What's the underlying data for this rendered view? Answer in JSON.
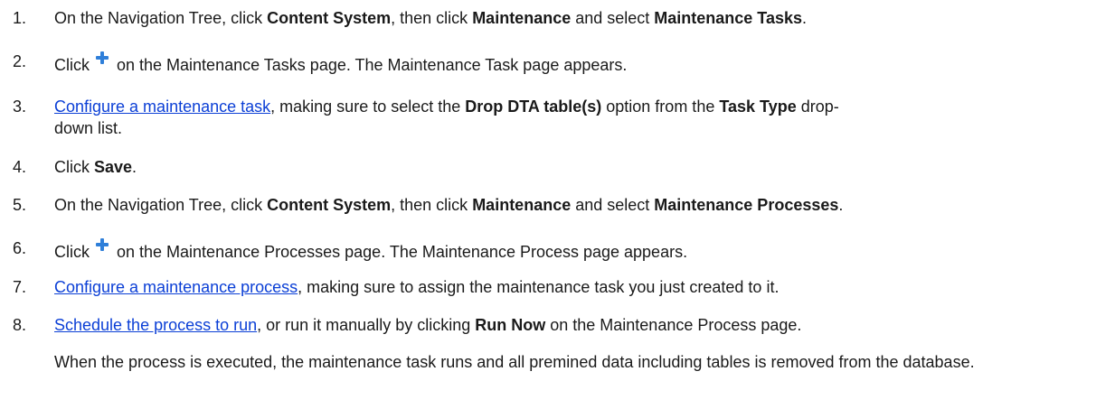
{
  "steps": [
    {
      "number": "1.",
      "t1": "On the Navigation Tree, click ",
      "b1": "Content System",
      "t2": ", then click ",
      "b2": "Maintenance",
      "t3": " and select ",
      "b3": "Maintenance Tasks",
      "t4": "."
    },
    {
      "number": "2.",
      "t1": "Click",
      "icon": "plus-icon",
      "t2": "on the Maintenance Tasks page. The Maintenance Task page appears."
    },
    {
      "number": "3.",
      "link": "Configure a maintenance task",
      "t1": ", making sure to select the ",
      "b1": "Drop DTA table(s)",
      "t2": " option from the ",
      "b2": "Task Type",
      "t3": " drop-",
      "t4": "down list."
    },
    {
      "number": "4.",
      "t1": "Click ",
      "b1": "Save",
      "t2": "."
    },
    {
      "number": "5.",
      "t1": "On the Navigation Tree, click ",
      "b1": "Content System",
      "t2": ", then click ",
      "b2": "Maintenance",
      "t3": " and select ",
      "b3": "Maintenance Processes",
      "t4": "."
    },
    {
      "number": "6.",
      "t1": "Click",
      "icon": "plus-icon",
      "t2": "on the Maintenance Processes page. The Maintenance Process page appears."
    },
    {
      "number": "7.",
      "link": "Configure a maintenance process",
      "t1": ", making sure to assign the maintenance task you just created to it."
    },
    {
      "number": "8.",
      "link": "Schedule the process to run",
      "t1": ", or run it manually by clicking ",
      "b1": "Run Now",
      "t2": " on the Maintenance Process page."
    }
  ],
  "note": "When the process is executed, the maintenance task runs and all premined data including tables is removed from the database.",
  "colors": {
    "text": "#1a1a1a",
    "link": "#0b3fd6",
    "icon": "#2f7fd9"
  }
}
